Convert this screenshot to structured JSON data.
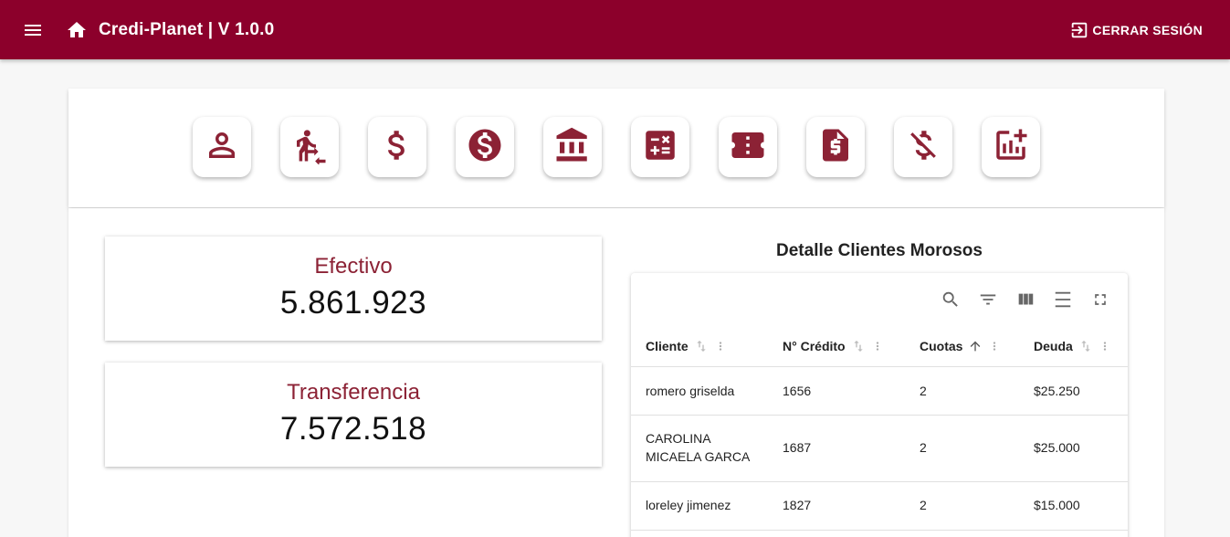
{
  "header": {
    "title": "Credi-Planet | V 1.0.0",
    "logout_label": "CERRAR SESIÓN",
    "color": "#8c002b"
  },
  "toolbar": {
    "icons": [
      "person-icon",
      "transfer-person-icon",
      "dollar-icon",
      "dollar-circle-icon",
      "bank-icon",
      "calculator-icon",
      "ticket-icon",
      "dollar-document-icon",
      "no-money-icon",
      "add-chart-icon"
    ],
    "icon_color": "#8c2235"
  },
  "stats": {
    "efectivo": {
      "label": "Efectivo",
      "value": "5.861.923"
    },
    "transferencia": {
      "label": "Transferencia",
      "value": "7.572.518"
    }
  },
  "table": {
    "title": "Detalle Clientes Morosos",
    "tools": [
      "search-icon",
      "filter-icon",
      "columns-icon",
      "density-icon",
      "fullscreen-icon"
    ],
    "columns": [
      "Cliente",
      "N° Crédito",
      "Cuotas",
      "Deuda"
    ],
    "sorted_column": "Cuotas",
    "rows": [
      {
        "cliente": "romero griselda",
        "credito": "1656",
        "cuotas": "2",
        "deuda": "$25.250"
      },
      {
        "cliente": "CAROLINA MICAELA GARCA",
        "credito": "1687",
        "cuotas": "2",
        "deuda": "$25.000"
      },
      {
        "cliente": "loreley jimenez",
        "credito": "1827",
        "cuotas": "2",
        "deuda": "$15.000"
      }
    ]
  }
}
